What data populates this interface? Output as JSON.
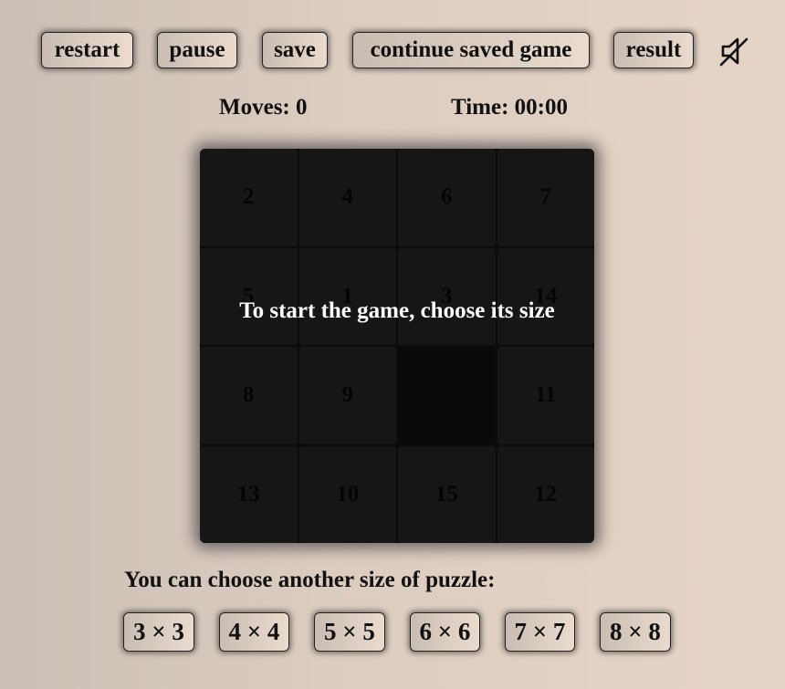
{
  "toolbar": {
    "restart_label": "restart",
    "pause_label": "pause",
    "save_label": "save",
    "continue_label": "continue saved game",
    "result_label": "result",
    "sound_icon": "sound-muted-icon"
  },
  "stats": {
    "moves_text": "Moves: 0",
    "time_text": "Time: 00:00"
  },
  "board": {
    "size": 4,
    "tiles": [
      "2",
      "4",
      "6",
      "7",
      "5",
      "1",
      "3",
      "14",
      "8",
      "9",
      "",
      "11",
      "13",
      "10",
      "15",
      "12"
    ],
    "overlay_message": "To start the game, choose its size"
  },
  "size_chooser": {
    "label": "You can choose another size of puzzle:",
    "options": [
      "3 × 3",
      "4 × 4",
      "5 × 5",
      "6 × 6",
      "7 × 7",
      "8 × 8"
    ]
  },
  "colors": {
    "background": "#dccdc0",
    "board": "#161616",
    "overlay_text": "#ffffff"
  }
}
